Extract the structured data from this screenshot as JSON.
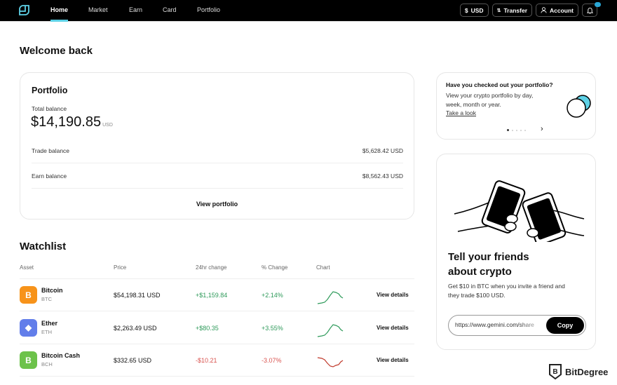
{
  "topbar": {
    "logo": "gemini-logo",
    "nav": [
      {
        "label": "Home",
        "active": true
      },
      {
        "label": "Market",
        "active": false
      },
      {
        "label": "Earn",
        "active": false
      },
      {
        "label": "Card",
        "active": false
      },
      {
        "label": "Portfolio",
        "active": false
      }
    ],
    "currency_button": {
      "icon": "dollar-icon",
      "label": "USD"
    },
    "transfer_button": {
      "icon": "transfer-icon",
      "label": "Transfer"
    },
    "account_button": {
      "icon": "user-icon",
      "label": "Account"
    },
    "notifications": {
      "icon": "bell-icon"
    },
    "accent_color": "#5ed1e6"
  },
  "welcome": "Welcome back",
  "portfolio": {
    "title": "Portfolio",
    "total_label": "Total balance",
    "total_value": "$14,190.85",
    "total_currency": "USD",
    "rows": [
      {
        "label": "Trade balance",
        "value": "$5,628.42 USD"
      },
      {
        "label": "Earn balance",
        "value": "$8,562.43 USD"
      }
    ],
    "view_link": "View portfolio"
  },
  "watchlist": {
    "title": "Watchlist",
    "columns": [
      "Asset",
      "Price",
      "24hr change",
      "% Change",
      "Chart",
      ""
    ],
    "rows": [
      {
        "name": "Bitcoin",
        "symbol": "BTC",
        "icon_glyph": "B",
        "icon_color": "#f7931a",
        "price": "$54,198.31 USD",
        "change": "+$1,159.84",
        "pct": "+2.14%",
        "trend": "up",
        "action": "View details"
      },
      {
        "name": "Ether",
        "symbol": "ETH",
        "icon_glyph": "◆",
        "icon_color": "#627eea",
        "price": "$2,263.49 USD",
        "change": "+$80.35",
        "pct": "+3.55%",
        "trend": "up",
        "action": "View details"
      },
      {
        "name": "Bitcoin Cash",
        "symbol": "BCH",
        "icon_glyph": "B",
        "icon_color": "#6cc24a",
        "price": "$332.65 USD",
        "change": "-$10.21",
        "pct": "-3.07%",
        "trend": "down",
        "action": "View details"
      }
    ]
  },
  "promo": {
    "title": "Have you checked out your portfolio?",
    "text": "View your crypto portfolio by day, week, month or year.",
    "link": "Take a look",
    "carousel_active": 1,
    "carousel_count": 5
  },
  "refer": {
    "title": "Tell your friends about crypto",
    "text": "Get $10 in BTC when you invite a friend and they trade $100 USD.",
    "share_value": "https://www.gemini.com/share",
    "copy_label": "Copy"
  },
  "watermark": "BitDegree"
}
